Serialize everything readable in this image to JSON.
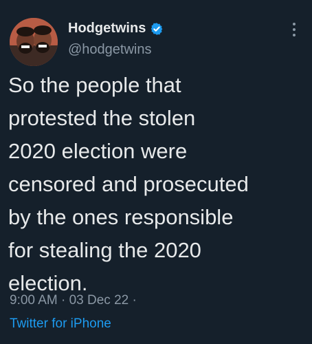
{
  "author": {
    "display_name": "Hodgetwins",
    "handle": "@hodgetwins",
    "verified_icon": "verified-badge-icon",
    "avatar_icon": "profile-photo"
  },
  "menu": {
    "icon": "more-vertical-icon"
  },
  "tweet": {
    "lines": [
      "So the people that",
      "protested the stolen",
      "2020 election were",
      "censored and prosecuted",
      "by the ones responsible",
      "for stealing the 2020",
      "election."
    ],
    "timestamp": "9:00 AM · 03 Dec 22 ·",
    "source": "Twitter for iPhone"
  },
  "colors": {
    "background": "#15202b",
    "text": "#e7e9ea",
    "secondary": "#8b98a5",
    "accent": "#1d9bf0"
  }
}
